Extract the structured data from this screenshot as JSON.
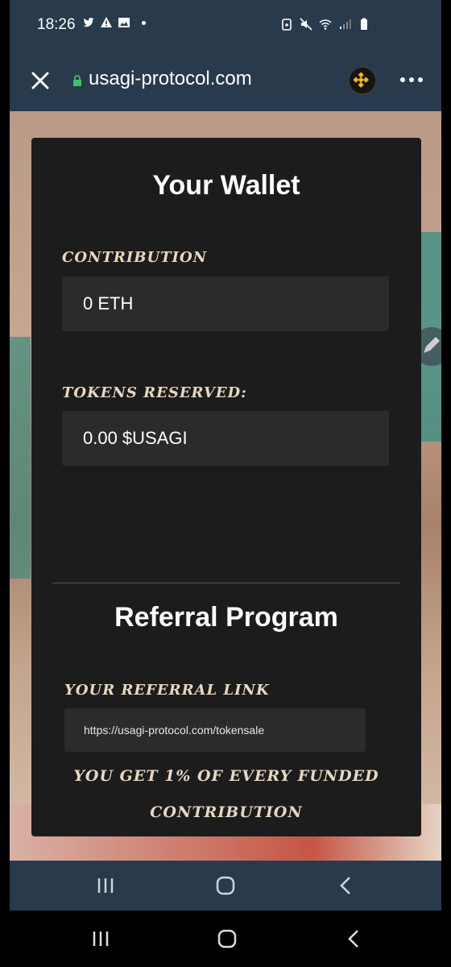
{
  "status_bar": {
    "time": "18:26",
    "left_icons": [
      "twitter-icon",
      "warning-icon",
      "image-icon"
    ],
    "right_icons": [
      "battery-saver-icon",
      "mute-icon",
      "wifi-icon",
      "signal-icon",
      "battery-icon"
    ]
  },
  "browser": {
    "url": "usagi-protocol.com",
    "close_icon": "close-icon",
    "lock_icon": "lock-icon",
    "extension_icon": "bnb-logo-icon",
    "menu_icon": "more-icon"
  },
  "wallet": {
    "title": "Your Wallet",
    "contribution_label": "Contribution",
    "contribution_value": "0 ETH",
    "tokens_label": "Tokens Reserved:",
    "tokens_value": "0.00 $USAGI"
  },
  "referral": {
    "title": "Referral Program",
    "link_label": "Your Referral Link",
    "link_value": "https://usagi-protocol.com/tokensale",
    "note_line1": "You get 1% of every funded",
    "note_line2": "contribution"
  },
  "navigation": {
    "recent_icon": "recent-apps-icon",
    "home_icon": "home-icon",
    "back_icon": "back-icon"
  },
  "colors": {
    "card_bg": "#1c1c1c",
    "field_bg": "#2b2b2b",
    "label_color": "#e9d6c2",
    "toolbar_bg": "#2a3a4d"
  }
}
